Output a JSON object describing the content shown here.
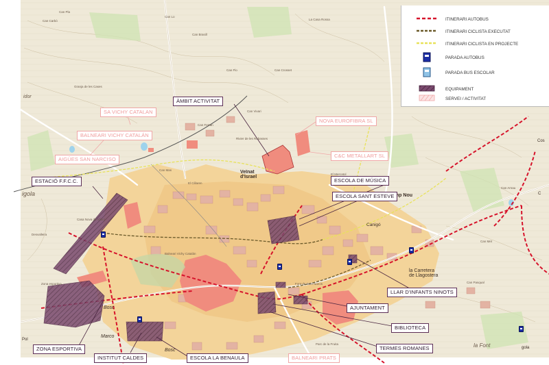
{
  "map": {
    "title": "",
    "equipment_labels": [
      {
        "id": "ambit",
        "text": "ÀMBIT ACTIVITAT"
      },
      {
        "id": "estacio",
        "text": "ESTACIÓ F.F.C.C."
      },
      {
        "id": "musica",
        "text": "ESCOLA DE MÚSICA"
      },
      {
        "id": "santesteve",
        "text": "ESCOLA SANT ESTEVE"
      },
      {
        "id": "llar",
        "text": "LLAR D'INFANTS NINOTS"
      },
      {
        "id": "ajuntament",
        "text": "AJUNTAMENT"
      },
      {
        "id": "biblioteca",
        "text": "BIBLIOTECA"
      },
      {
        "id": "termes",
        "text": "TERMES ROMANES"
      },
      {
        "id": "zona",
        "text": "ZONA ESPORTIVA"
      },
      {
        "id": "institut",
        "text": "INSTITUT CALDES"
      },
      {
        "id": "benaula",
        "text": "ESCOLA LA BENAULA"
      }
    ],
    "service_labels": [
      {
        "id": "vichycatalan",
        "text": "SA VICHY CATALAN"
      },
      {
        "id": "balneari",
        "text": "BALNEARI VICHY CATALÁN"
      },
      {
        "id": "aigues",
        "text": "AIGÜES SAN NARCISO"
      },
      {
        "id": "nova",
        "text": "NOVA EUROFIBRA SL"
      },
      {
        "id": "cc",
        "text": "C&C METALLART SL"
      },
      {
        "id": "prats",
        "text": "BALNEARI PRATS"
      }
    ],
    "place_names": [
      {
        "id": "veinat",
        "text": "Veïnat\nd'Israel"
      },
      {
        "id": "camponou",
        "text": "Camp Nou"
      },
      {
        "id": "canigo",
        "text": "Canigó"
      },
      {
        "id": "carretera",
        "text": "la Carretera\nde Llagostera"
      },
      {
        "id": "font",
        "text": "la Font"
      },
      {
        "id": "bosc",
        "text": "Bosc"
      },
      {
        "id": "bosc2",
        "text": "Bosc"
      },
      {
        "id": "marco",
        "text": "Marco"
      },
      {
        "id": "pol",
        "text": "Pol"
      },
      {
        "id": "igola",
        "text": "igola"
      },
      {
        "id": "gola",
        "text": "gola"
      },
      {
        "id": "idor",
        "text": "idor"
      },
      {
        "id": "cosc",
        "text": "Cos"
      },
      {
        "id": "c2",
        "text": "C"
      }
    ]
  },
  "legend": {
    "items": [
      {
        "id": "bus_route",
        "label": "ITINERARI AUTOBUS",
        "color": "#d6132b"
      },
      {
        "id": "bike_done",
        "label": "ITINERARI CICLISTA EXECUTAT",
        "color": "#6b5a2a"
      },
      {
        "id": "bike_plan",
        "label": "ITINERARI CICLISTA EN PROJECTE",
        "color": "#e8e25a"
      },
      {
        "id": "bus_stop",
        "label": "PARADA AUTOBUS",
        "color": "#1c2ea6"
      },
      {
        "id": "school_stop",
        "label": "PARADA BUS ESCOLAR",
        "color": "#8fc3e6"
      },
      {
        "id": "equipment",
        "label": "EQUIPAMENT",
        "color": "#7a4a6e"
      },
      {
        "id": "service",
        "label": "SERVEI / ACTIVITAT",
        "color": "#f0a7a7"
      }
    ]
  }
}
